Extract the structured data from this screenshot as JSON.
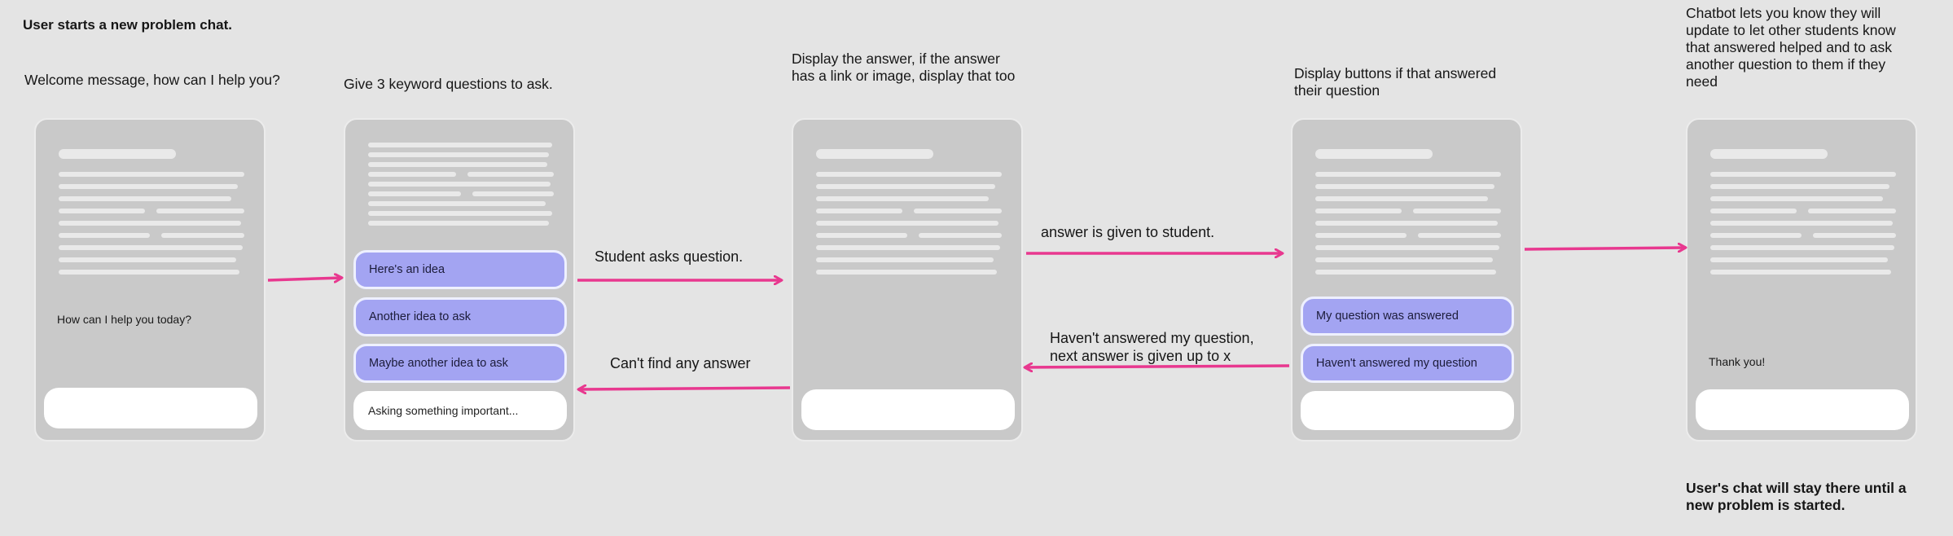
{
  "header": {
    "title": "User starts a new problem chat."
  },
  "captions": {
    "step1": "Welcome message, how can I help you?",
    "step2": "Give 3 keyword questions to ask.",
    "step3": "Display the answer, if the answer\nhas a link or image, display that too",
    "step4": "Display buttons if that answered\ntheir question",
    "step5": "Chatbot lets you know they will\nupdate to let other students know\nthat answered helped and to ask\nanother question to them if they\nneed",
    "footer": "User's chat will stay there until a\nnew problem is started."
  },
  "flow_labels": {
    "student_asks": "Student asks question.",
    "answer_given": "answer is given to student.",
    "cant_find": "Can't find any answer",
    "havent_answered": "Haven't answered my question,\nnext answer is given up to x"
  },
  "screen1": {
    "message": "How can I help you today?"
  },
  "screen2": {
    "options": [
      "Here's an idea",
      "Another idea to ask",
      "Maybe another idea to ask"
    ],
    "input_value": "Asking something important..."
  },
  "screen4": {
    "buttons": [
      "My question was answered",
      "Haven't answered my question"
    ]
  },
  "screen5": {
    "message": "Thank you!"
  },
  "colors": {
    "arrow": "#e8388f",
    "chip": "#a3a4f2",
    "phone": "#c9c9c9",
    "background": "#e4e4e4"
  }
}
